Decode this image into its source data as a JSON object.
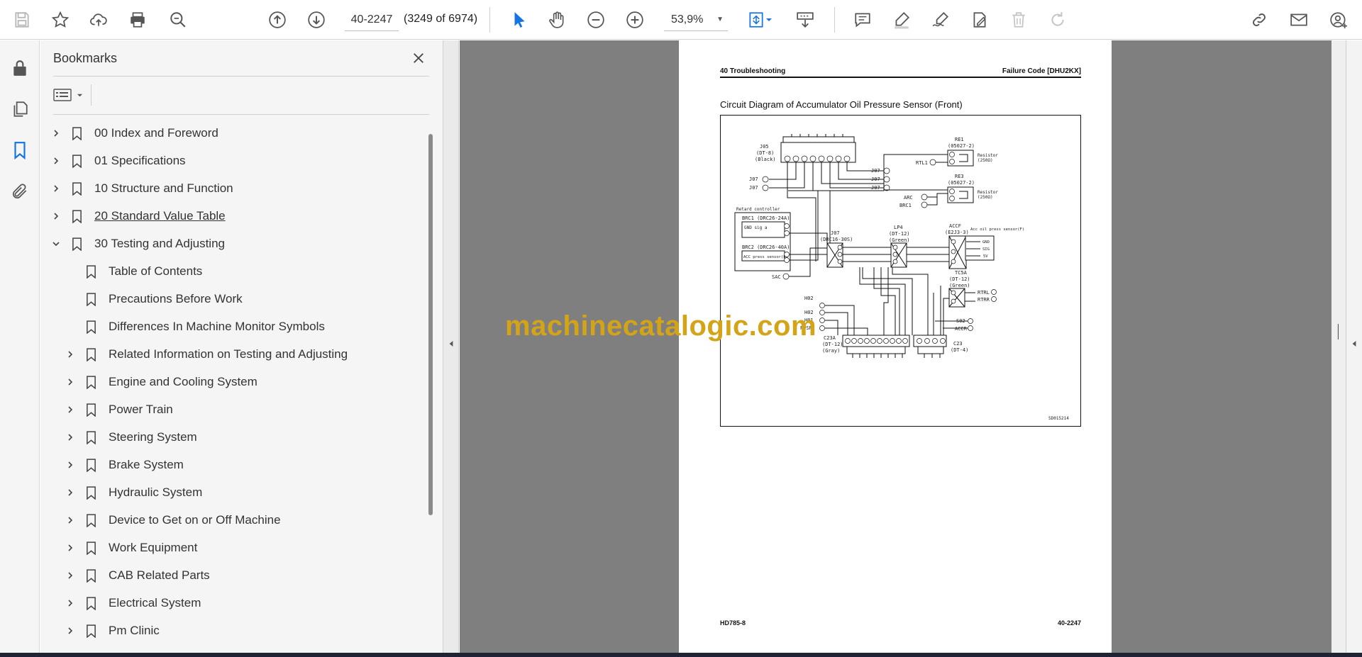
{
  "toolbar": {
    "page_current": "40-2247",
    "page_count": "(3249 of 6974)",
    "zoom": "53,9%"
  },
  "panel": {
    "title": "Bookmarks",
    "items": [
      {
        "label": "00 Index and Foreword",
        "level": 0,
        "expanded": false
      },
      {
        "label": "01 Specifications",
        "level": 0,
        "expanded": false
      },
      {
        "label": "10 Structure and Function",
        "level": 0,
        "expanded": false
      },
      {
        "label": "20 Standard Value Table",
        "level": 0,
        "expanded": false
      },
      {
        "label": "30 Testing and Adjusting",
        "level": 0,
        "expanded": true
      },
      {
        "label": "Table of Contents",
        "level": 1,
        "leaf": true
      },
      {
        "label": "Precautions Before Work",
        "level": 1,
        "leaf": true
      },
      {
        "label": "Differences In Machine Monitor Symbols",
        "level": 1,
        "leaf": true
      },
      {
        "label": "Related Information on Testing and Adjusting",
        "level": 1,
        "expanded": false
      },
      {
        "label": "Engine and Cooling System",
        "level": 1,
        "expanded": false
      },
      {
        "label": "Power Train",
        "level": 1,
        "expanded": false
      },
      {
        "label": "Steering System",
        "level": 1,
        "expanded": false
      },
      {
        "label": "Brake System",
        "level": 1,
        "expanded": false
      },
      {
        "label": "Hydraulic System",
        "level": 1,
        "expanded": false
      },
      {
        "label": "Device to Get on or Off Machine",
        "level": 1,
        "expanded": false
      },
      {
        "label": "Work Equipment",
        "level": 1,
        "expanded": false
      },
      {
        "label": "CAB Related Parts",
        "level": 1,
        "expanded": false
      },
      {
        "label": "Electrical System",
        "level": 1,
        "expanded": false
      },
      {
        "label": "Pm Clinic",
        "level": 1,
        "expanded": false
      }
    ]
  },
  "document": {
    "header_left": "40 Troubleshooting",
    "header_right": "Failure Code [DHU2KX]",
    "heading": "Circuit Diagram of Accumulator Oil Pressure Sensor (Front)",
    "footer_left": "HD785-8",
    "footer_right": "40-2247",
    "watermark": "machinecatalogic.com",
    "diagram": {
      "j05": "J05",
      "j05_type": "(DT-8)",
      "j05_color": "(Black)",
      "re1": "RE1",
      "re1_type": "(05027-2)",
      "re3": "RE3",
      "re3_type": "(05027-2)",
      "resistor": "Resistor",
      "resistor_val": "(250Ω)",
      "rtl1": "RTL1",
      "arc": "ARC",
      "brc1_pin": "BRC1",
      "retard": "Retard controller",
      "brc1": "BRC1 (DRC26-24A)",
      "brc2": "BRC2 (DRC26-40A)",
      "gnd_label": "GND sig a",
      "acc_press_sensor": "ACC press sensor(F)",
      "j07_label": "J07",
      "j07_type": "(DRC16-30S)",
      "lp4": "LP4",
      "lp4_type": "(DT-12)",
      "lp4_color": "(Green)",
      "accf": "ACCF",
      "accf_type": "(E2J3-3)",
      "acc_sensor": "Acc oil press sensor(F)",
      "sac": "SAC",
      "tc5a": "TC5A",
      "tc5a_type": "(DT-12)",
      "tc5a_color": "(Green)",
      "rtrl": "RTRL",
      "rtrr": "RTRR",
      "s02": "S02",
      "accr": "ACCR",
      "h02": "H02",
      "h01": "H01",
      "ppsr": "PPSR",
      "c23a": "C23A",
      "c23a_type": "(DT-12)",
      "c23a_color": "(Gray)",
      "c23": "C23",
      "c23_type": "(DT-4)",
      "code": "SD015214",
      "j07a": "J07",
      "j07b": "J07",
      "j07c": "J07",
      "j07d": "J07",
      "j07e": "J07",
      "gnd": "GND",
      "sig": "SIG",
      "5v": "5V"
    }
  }
}
